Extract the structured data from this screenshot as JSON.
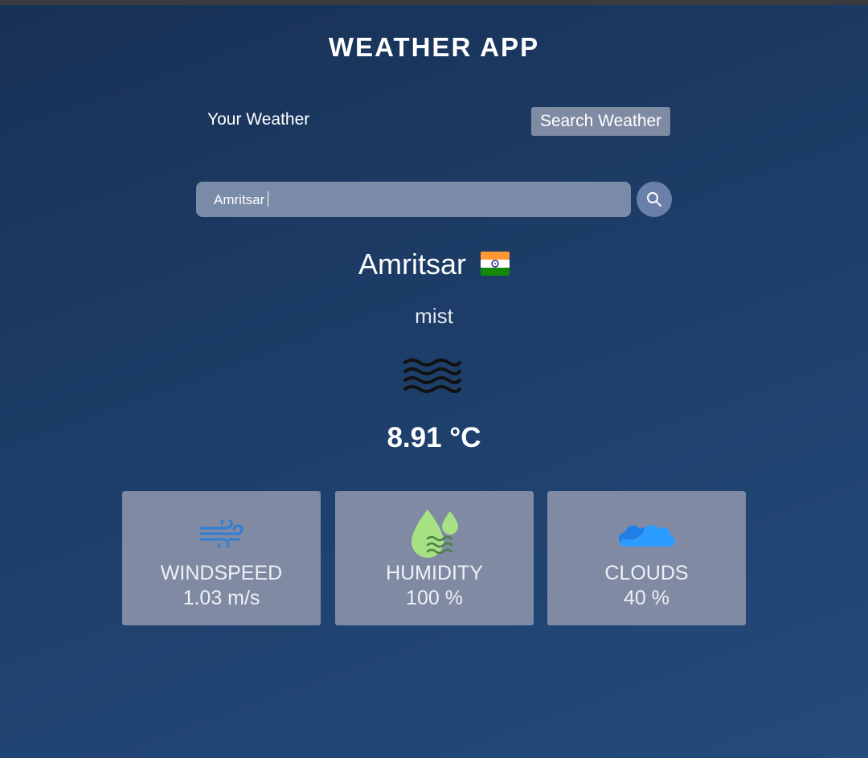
{
  "app": {
    "title": "WEATHER APP"
  },
  "tabs": {
    "your_weather": "Your Weather",
    "search_weather": "Search Weather"
  },
  "search": {
    "value": "Amritsar",
    "icon": "search-icon"
  },
  "weather": {
    "city": "Amritsar",
    "country_flag": "india-flag-icon",
    "description": "mist",
    "condition_icon": "mist-icon",
    "temperature": "8.91 °C"
  },
  "cards": [
    {
      "icon": "wind-icon",
      "label": "WINDSPEED",
      "value": "1.03 m/s",
      "icon_color": "#2f7fd6"
    },
    {
      "icon": "humidity-icon",
      "label": "HUMIDITY",
      "value": "100 %",
      "icon_color": "#9be07a"
    },
    {
      "icon": "clouds-icon",
      "label": "CLOUDS",
      "value": "40 %",
      "icon_color": "#1e90ff"
    }
  ],
  "colors": {
    "background_top": "#183156",
    "background_bottom": "#244b7c",
    "card_background": "#808aa3",
    "search_field": "#7a8ba7",
    "tab_active": "#7f8aa3"
  }
}
